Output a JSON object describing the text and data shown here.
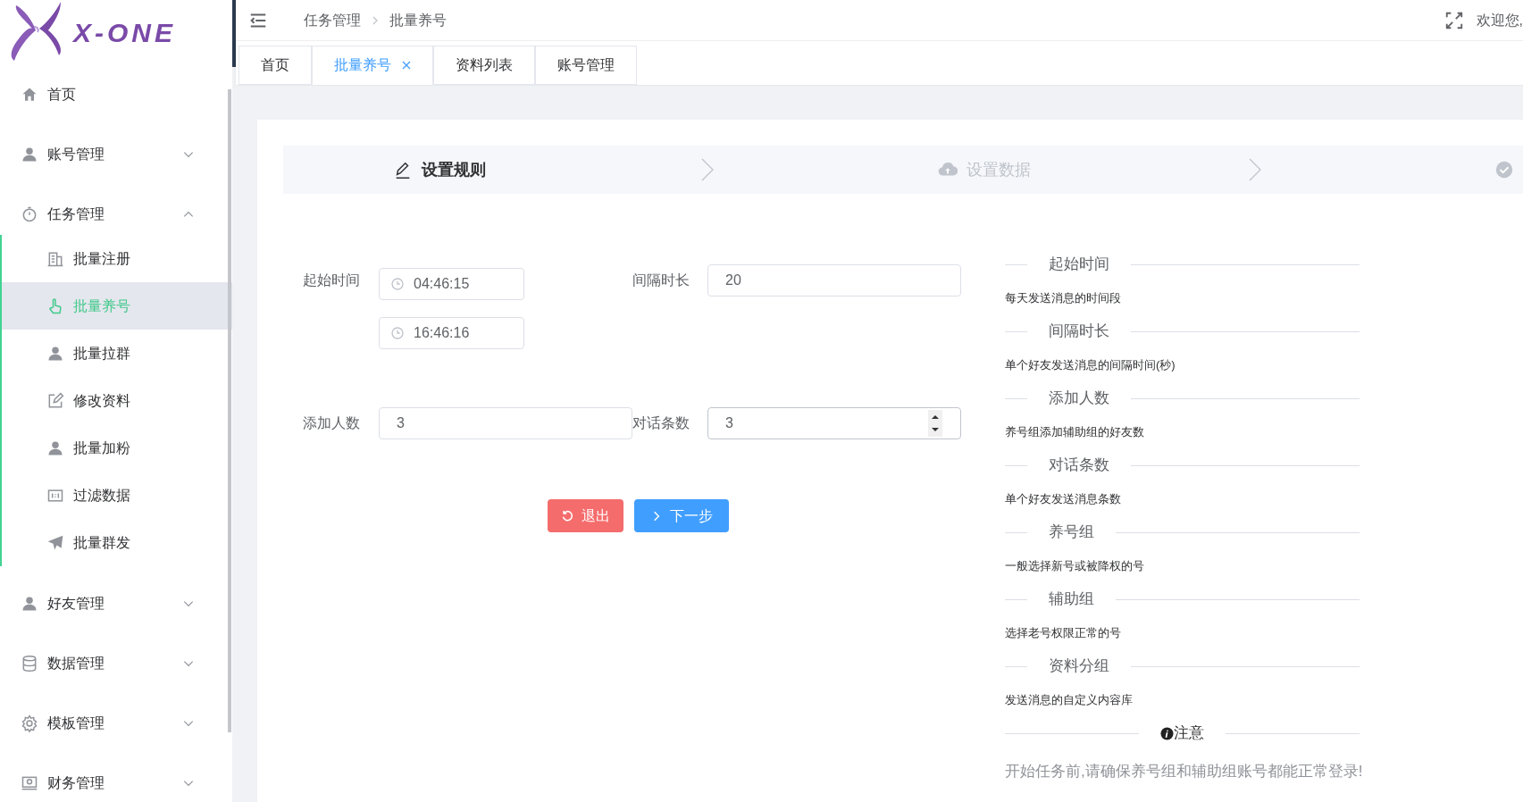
{
  "logo": {
    "text": "X-ONE"
  },
  "menu": [
    {
      "label": "首页",
      "kind": "link",
      "selected": false
    },
    {
      "label": "账号管理",
      "kind": "group",
      "expanded": false,
      "selected": false
    },
    {
      "label": "任务管理",
      "kind": "group",
      "expanded": true,
      "selected": false,
      "children": [
        {
          "label": "批量注册",
          "selected": false
        },
        {
          "label": "批量养号",
          "selected": true
        },
        {
          "label": "批量拉群",
          "selected": false
        },
        {
          "label": "修改资料",
          "selected": false
        },
        {
          "label": "批量加粉",
          "selected": false
        },
        {
          "label": "过滤数据",
          "selected": false
        },
        {
          "label": "批量群发",
          "selected": false
        }
      ]
    },
    {
      "label": "好友管理",
      "kind": "group",
      "expanded": false,
      "selected": false
    },
    {
      "label": "数据管理",
      "kind": "group",
      "expanded": false,
      "selected": false
    },
    {
      "label": "模板管理",
      "kind": "group",
      "expanded": false,
      "selected": false
    },
    {
      "label": "财务管理",
      "kind": "group",
      "expanded": false,
      "selected": false
    }
  ],
  "breadcrumb": [
    "任务管理",
    "批量养号"
  ],
  "header": {
    "welcome": "欢迎您,"
  },
  "tabs": [
    {
      "label": "首页",
      "selected": false
    },
    {
      "label": "批量养号",
      "selected": true
    },
    {
      "label": "资料列表",
      "selected": false
    },
    {
      "label": "账号管理",
      "selected": false
    }
  ],
  "steps": [
    {
      "label": "设置规则",
      "active": true
    },
    {
      "label": "设置数据",
      "active": false
    },
    {
      "active": false
    }
  ],
  "form": {
    "start_time": {
      "label": "起始时间",
      "from": "04:46:15",
      "to": "16:46:16"
    },
    "interval": {
      "label": "间隔时长",
      "value": "20"
    },
    "add_count": {
      "label": "添加人数",
      "value": "3"
    },
    "message_count": {
      "label": "对话条数",
      "value": "3"
    }
  },
  "buttons": [
    {
      "label": "退出",
      "kind": "danger"
    },
    {
      "label": "下一步",
      "kind": "primary"
    }
  ],
  "help": [
    {
      "title": "起始时间",
      "text": "每天发送消息的时间段"
    },
    {
      "title": "间隔时长",
      "text": "单个好友发送消息的间隔时间(秒)"
    },
    {
      "title": "添加人数",
      "text": "养号组添加辅助组的好友数"
    },
    {
      "title": "对话条数",
      "text": "单个好友发送消息条数"
    },
    {
      "title": "养号组",
      "text": "一般选择新号或被降权的号"
    },
    {
      "title": "辅助组",
      "text": "选择老号权限正常的号"
    },
    {
      "title": "资料分组",
      "text": "发送消息的自定义内容库"
    }
  ],
  "notice": {
    "title": "注意",
    "text": "开始任务前,请确保养号组和辅助组账号都能正常登录!"
  }
}
